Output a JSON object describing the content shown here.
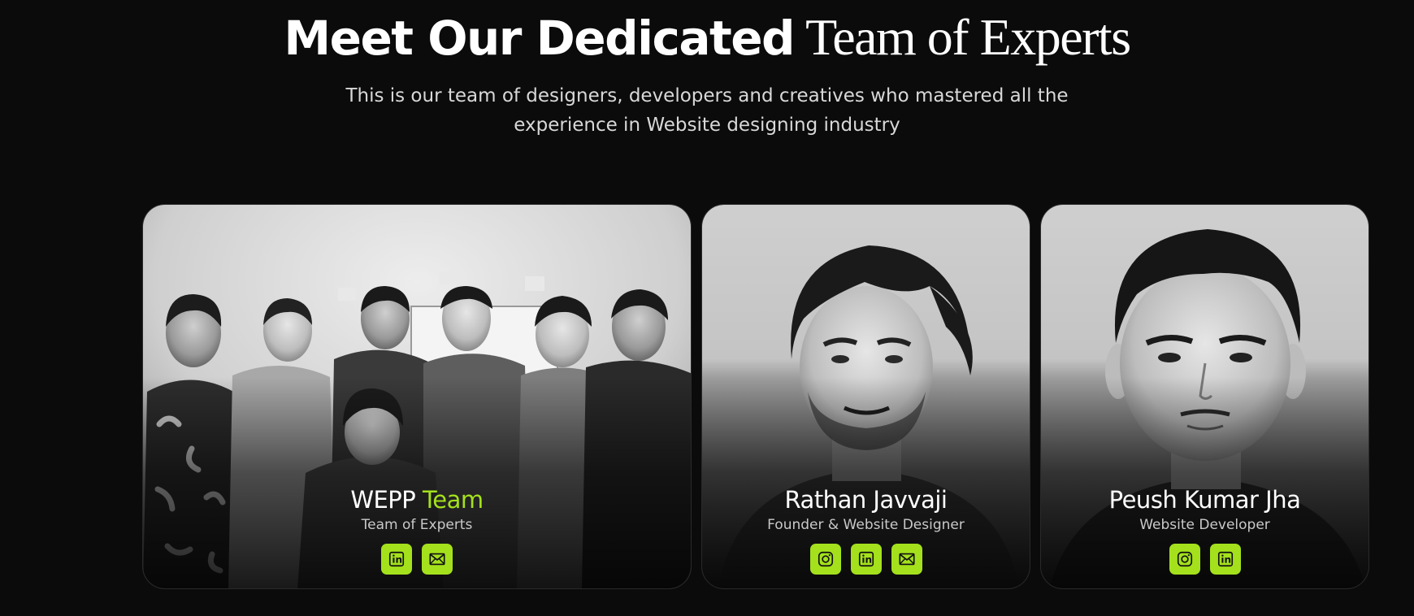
{
  "header": {
    "title_sans": "Meet Our Dedicated",
    "title_serif": "Team of Experts",
    "subtitle": "This is our team of designers, developers and creatives who mastered all the experience in Website designing industry"
  },
  "theme": {
    "background": "#0b0b0b",
    "accent": "#a4e11c"
  },
  "team": [
    {
      "name_main": "WEPP",
      "name_accent": "Team",
      "role": "Team of Experts",
      "photo": "group-photo",
      "socials": [
        "linkedin-icon",
        "mail-icon"
      ]
    },
    {
      "name_main": "Rathan Javvaji",
      "role": "Founder & Website Designer",
      "photo": "portrait-photo",
      "socials": [
        "instagram-icon",
        "linkedin-icon",
        "mail-icon"
      ]
    },
    {
      "name_main": "Peush Kumar Jha",
      "role": "Website Developer",
      "photo": "portrait-photo",
      "socials": [
        "instagram-icon",
        "linkedin-icon"
      ]
    }
  ]
}
